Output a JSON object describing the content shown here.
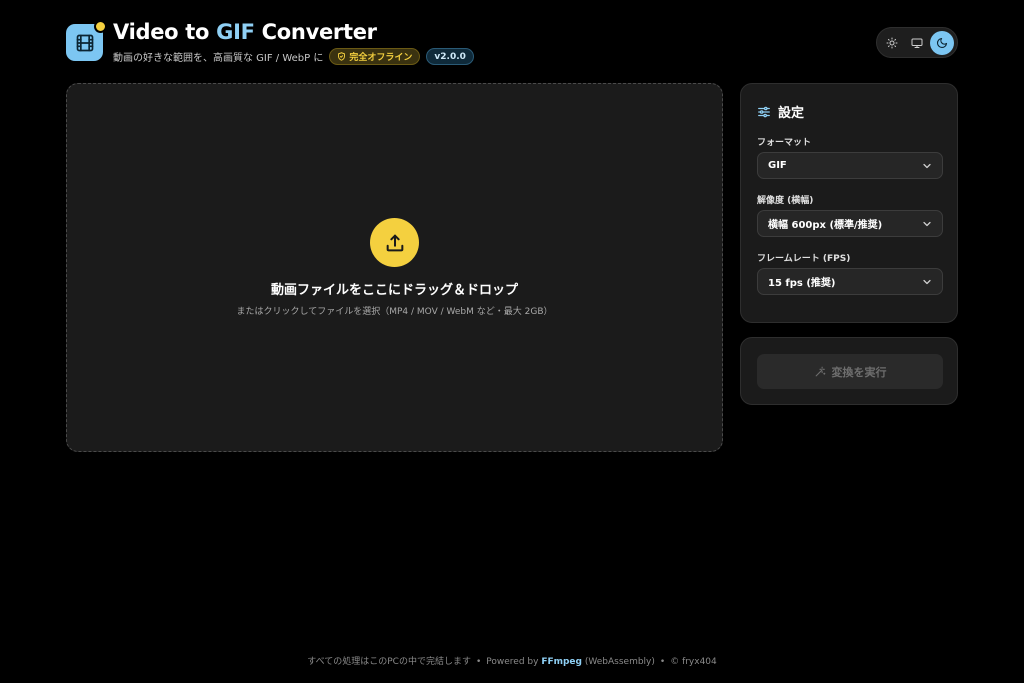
{
  "header": {
    "title_pre": "Video to ",
    "title_accent": "GIF",
    "title_post": " Converter",
    "subtitle": "動画の好きな範囲を、高画質な GIF / WebP に",
    "badge_offline": "完全オフライン",
    "badge_version": "v2.0.0"
  },
  "theme_toggle": {
    "options": [
      "light",
      "system",
      "dark"
    ],
    "active": "dark",
    "accent_color": "#7cc6f2"
  },
  "dropzone": {
    "title": "動画ファイルをここにドラッグ＆ドロップ",
    "subtitle": "またはクリックしてファイルを選択（MP4 / MOV / WebM など・最大 2GB）",
    "icon": "upload-icon",
    "icon_color": "#f4d03f"
  },
  "settings": {
    "title": "設定",
    "format": {
      "label": "フォーマット",
      "value": "GIF"
    },
    "resolution": {
      "label": "解像度 (横幅)",
      "value": "横幅 600px (標準/推奨)"
    },
    "framerate": {
      "label": "フレームレート (FPS)",
      "value": "15 fps (推奨)"
    }
  },
  "convert": {
    "label": "変換を実行",
    "disabled": true
  },
  "footer": {
    "processing": "すべての処理はこのPCの中で完結します",
    "powered_by": "Powered by",
    "ffmpeg": "FFmpeg",
    "wasm": "(WebAssembly)",
    "copyright": "© fryx404",
    "separator": "•"
  }
}
